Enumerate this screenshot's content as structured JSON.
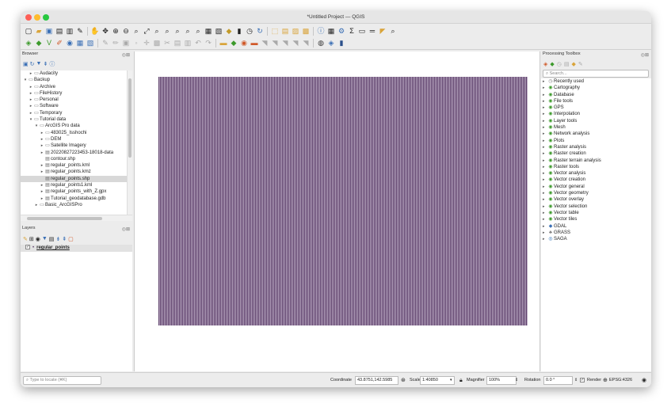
{
  "window": {
    "title": "*Untitled Project — QGIS"
  },
  "browser": {
    "title": "Browser",
    "items": [
      {
        "label": "Audacity",
        "depth": 1,
        "arrow": "▸",
        "icon": "folder"
      },
      {
        "label": "Backup",
        "depth": 0,
        "arrow": "▾",
        "icon": "folder"
      },
      {
        "label": "Archive",
        "depth": 1,
        "arrow": "▸",
        "icon": "folder"
      },
      {
        "label": "FileHistory",
        "depth": 1,
        "arrow": "▸",
        "icon": "folder"
      },
      {
        "label": "Personal",
        "depth": 1,
        "arrow": "▸",
        "icon": "folder"
      },
      {
        "label": "Software",
        "depth": 1,
        "arrow": "▸",
        "icon": "folder"
      },
      {
        "label": "Temporary",
        "depth": 1,
        "arrow": "▸",
        "icon": "folder"
      },
      {
        "label": "Tutorial data",
        "depth": 1,
        "arrow": "▾",
        "icon": "folder"
      },
      {
        "label": "ArcGIS Pro data",
        "depth": 2,
        "arrow": "▾",
        "icon": "folder"
      },
      {
        "label": "483025_Isshochi",
        "depth": 3,
        "arrow": "▸",
        "icon": "folder"
      },
      {
        "label": "DEM",
        "depth": 3,
        "arrow": "▸",
        "icon": "folder"
      },
      {
        "label": "Satellite Imagery",
        "depth": 3,
        "arrow": "▸",
        "icon": "folder"
      },
      {
        "label": "20220827223453-18018-data",
        "depth": 3,
        "arrow": "▸",
        "icon": "file"
      },
      {
        "label": "contour.shp",
        "depth": 3,
        "arrow": "",
        "icon": "file"
      },
      {
        "label": "regular_points.kml",
        "depth": 3,
        "arrow": "▸",
        "icon": "file"
      },
      {
        "label": "regular_points.kmz",
        "depth": 3,
        "arrow": "▸",
        "icon": "file"
      },
      {
        "label": "regular_points.shp",
        "depth": 3,
        "arrow": "",
        "icon": "file",
        "selected": true
      },
      {
        "label": "regular_points1.kml",
        "depth": 3,
        "arrow": "▸",
        "icon": "file"
      },
      {
        "label": "regular_points_with_Z.gpx",
        "depth": 3,
        "arrow": "▸",
        "icon": "file"
      },
      {
        "label": "Tutorial_geodatabase.gdb",
        "depth": 3,
        "arrow": "▸",
        "icon": "file"
      },
      {
        "label": "Basic_ArcGISPro",
        "depth": 2,
        "arrow": "▸",
        "icon": "folder"
      }
    ]
  },
  "layers": {
    "title": "Layers",
    "items": [
      {
        "label": "regular_points",
        "checked": true
      }
    ]
  },
  "processing": {
    "title": "Processing Toolbox",
    "search_placeholder": "Search...",
    "items": [
      {
        "label": "Recently used",
        "icon": "clock"
      },
      {
        "label": "Cartography",
        "icon": "q"
      },
      {
        "label": "Database",
        "icon": "q"
      },
      {
        "label": "File tools",
        "icon": "q"
      },
      {
        "label": "GPS",
        "icon": "q"
      },
      {
        "label": "Interpolation",
        "icon": "q"
      },
      {
        "label": "Layer tools",
        "icon": "q"
      },
      {
        "label": "Mesh",
        "icon": "q"
      },
      {
        "label": "Network analysis",
        "icon": "q"
      },
      {
        "label": "Plots",
        "icon": "q"
      },
      {
        "label": "Raster analysis",
        "icon": "q"
      },
      {
        "label": "Raster creation",
        "icon": "q"
      },
      {
        "label": "Raster terrain analysis",
        "icon": "q"
      },
      {
        "label": "Raster tools",
        "icon": "q"
      },
      {
        "label": "Vector analysis",
        "icon": "q"
      },
      {
        "label": "Vector creation",
        "icon": "q"
      },
      {
        "label": "Vector general",
        "icon": "q"
      },
      {
        "label": "Vector geometry",
        "icon": "q"
      },
      {
        "label": "Vector overlay",
        "icon": "q"
      },
      {
        "label": "Vector selection",
        "icon": "q"
      },
      {
        "label": "Vector table",
        "icon": "q"
      },
      {
        "label": "Vector tiles",
        "icon": "q"
      },
      {
        "label": "GDAL",
        "icon": "gdal"
      },
      {
        "label": "GRASS",
        "icon": "grass"
      },
      {
        "label": "SAGA",
        "icon": "saga"
      }
    ]
  },
  "statusbar": {
    "locate_placeholder": "Type to locate (⌘K)",
    "coordinate_label": "Coordinate",
    "coordinate_value": "43.8751,142.5985",
    "scale_label": "Scale",
    "scale_value": "1:40850",
    "magnifier_label": "Magnifier",
    "magnifier_value": "100%",
    "rotation_label": "Rotation",
    "rotation_value": "0.0 °",
    "render_label": "Render",
    "crs_label": "EPSG:4326"
  },
  "colors": {
    "points": "#5a3c68",
    "processing_icon": "#3d9a2c"
  }
}
